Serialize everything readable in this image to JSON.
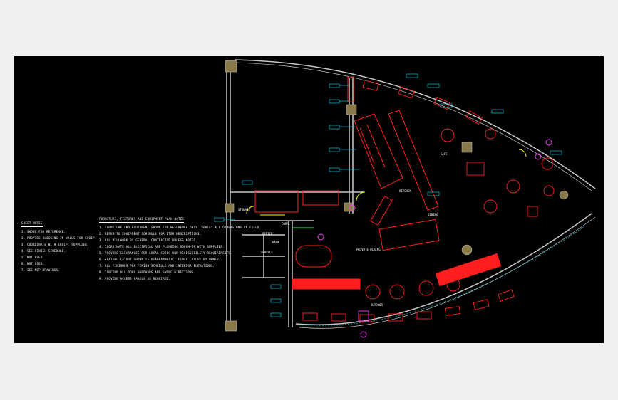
{
  "drawing": {
    "background": "#000000",
    "sheet": "#f0f0f0",
    "colors": {
      "walls": "#c8c8c8",
      "furniture": "#ff1e1e",
      "tags": "#00e5ff",
      "callouts": "#ff3cff",
      "columns": "#8a7a4a",
      "glazing": "#ffff00",
      "doors": "#ffff00",
      "accent_green": "#22cc22"
    }
  },
  "sheet_notes": {
    "heading": "SHEET NOTES",
    "items": [
      {
        "num": "1.",
        "text": "SHOWN FOR REFERENCE."
      },
      {
        "num": "2.",
        "text": "PROVIDE BLOCKING IN WALLS FOR EQUIP."
      },
      {
        "num": "3.",
        "text": "COORDINATE WITH EQUIP. SUPPLIER."
      },
      {
        "num": "4.",
        "text": "SEE FINISH SCHEDULE."
      },
      {
        "num": "5.",
        "text": "NOT USED."
      },
      {
        "num": "6.",
        "text": "NOT USED."
      },
      {
        "num": "7.",
        "text": "SEE MEP DRAWINGS."
      }
    ]
  },
  "equipment_notes": {
    "heading": "FURNITURE, FIXTURES AND EQUIPMENT PLAN NOTES",
    "items": [
      {
        "num": "1.",
        "text": "FURNITURE AND EQUIPMENT SHOWN FOR REFERENCE ONLY. VERIFY ALL DIMENSIONS IN FIELD."
      },
      {
        "num": "2.",
        "text": "REFER TO EQUIPMENT SCHEDULE FOR ITEM DESCRIPTIONS."
      },
      {
        "num": "3.",
        "text": "ALL MILLWORK BY GENERAL CONTRACTOR UNLESS NOTED."
      },
      {
        "num": "4.",
        "text": "COORDINATE ALL ELECTRICAL AND PLUMBING ROUGH-IN WITH SUPPLIER."
      },
      {
        "num": "5.",
        "text": "PROVIDE CLEARANCES PER LOCAL CODES AND ACCESSIBILITY REQUIREMENTS."
      },
      {
        "num": "6.",
        "text": "SEATING LAYOUT SHOWN IS DIAGRAMMATIC. FINAL LAYOUT BY OWNER."
      },
      {
        "num": "7.",
        "text": "ALL FINISHES PER FINISH SCHEDULE AND INTERIOR ELEVATIONS."
      },
      {
        "num": "8.",
        "text": "CONFIRM ALL DOOR HARDWARE AND SWING DIRECTIONS."
      },
      {
        "num": "9.",
        "text": "PROVIDE ACCESS PANELS AS REQUIRED."
      }
    ]
  },
  "room_labels": {
    "storage": "STORAGE",
    "office": "OFFICE",
    "back": "BACK",
    "corridor": "CORR.",
    "kitchen": "KITCHEN",
    "cafe": "CAFE",
    "dining": "DINING",
    "private_dining": "PRIVATE DINING",
    "outdoor": "OUTDOOR",
    "service": "SERVICE"
  },
  "tag_text": "XX-XX"
}
